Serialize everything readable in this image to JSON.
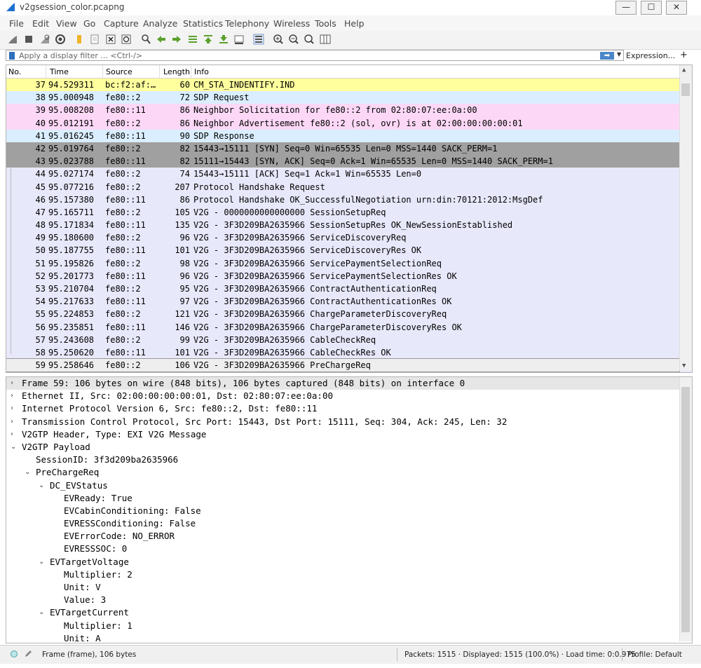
{
  "window": {
    "title": "v2gsession_color.pcapng",
    "min": "—",
    "max": "☐",
    "close": "✕"
  },
  "menu": [
    "File",
    "Edit",
    "View",
    "Go",
    "Capture",
    "Analyze",
    "Statistics",
    "Telephony",
    "Wireless",
    "Tools",
    "Help"
  ],
  "filter": {
    "placeholder": "Apply a display filter ... <Ctrl-/>",
    "apply_icon": "arrow-right-icon",
    "expression": "Expression...",
    "add": "+"
  },
  "columns": [
    "No.",
    "Time",
    "Source",
    "Length",
    "Info"
  ],
  "colors": {
    "yellow": "#ffff9e",
    "light_blue": "#daeeff",
    "pink": "#fcd8f6",
    "lavender": "#e8e8fb",
    "dark_gray": "#a0a0a0",
    "selected": "#eeeeee"
  },
  "packets": [
    {
      "no": "37",
      "time": "94.529311",
      "src": "bc:f2:af:…",
      "len": "60",
      "info": "CM_STA_INDENTIFY.IND",
      "color": "yellow"
    },
    {
      "no": "38",
      "time": "95.000948",
      "src": "fe80::2",
      "len": "72",
      "info": "SDP Request",
      "color": "light_blue"
    },
    {
      "no": "39",
      "time": "95.008208",
      "src": "fe80::11",
      "len": "86",
      "info": "Neighbor Solicitation for fe80::2 from 02:80:07:ee:0a:00",
      "color": "pink"
    },
    {
      "no": "40",
      "time": "95.012191",
      "src": "fe80::2",
      "len": "86",
      "info": "Neighbor Advertisement fe80::2 (sol, ovr) is at 02:00:00:00:00:01",
      "color": "pink"
    },
    {
      "no": "41",
      "time": "95.016245",
      "src": "fe80::11",
      "len": "90",
      "info": "SDP Response",
      "color": "light_blue"
    },
    {
      "no": "42",
      "time": "95.019764",
      "src": "fe80::2",
      "len": "82",
      "info": "15443→15111 [SYN] Seq=0 Win=65535 Len=0 MSS=1440 SACK_PERM=1",
      "color": "dark_gray"
    },
    {
      "no": "43",
      "time": "95.023788",
      "src": "fe80::11",
      "len": "82",
      "info": "15111→15443 [SYN, ACK] Seq=0 Ack=1 Win=65535 Len=0 MSS=1440 SACK_PERM=1",
      "color": "dark_gray"
    },
    {
      "no": "44",
      "time": "95.027174",
      "src": "fe80::2",
      "len": "74",
      "info": "15443→15111 [ACK] Seq=1 Ack=1 Win=65535 Len=0",
      "color": "lavender"
    },
    {
      "no": "45",
      "time": "95.077216",
      "src": "fe80::2",
      "len": "207",
      "info": "Protocol Handshake Request",
      "color": "lavender"
    },
    {
      "no": "46",
      "time": "95.157380",
      "src": "fe80::11",
      "len": "86",
      "info": "Protocol Handshake OK_SuccessfulNegotiation urn:din:70121:2012:MsgDef",
      "color": "lavender"
    },
    {
      "no": "47",
      "time": "95.165711",
      "src": "fe80::2",
      "len": "105",
      "info": "V2G - 0000000000000000 SessionSetupReq",
      "color": "lavender"
    },
    {
      "no": "48",
      "time": "95.171834",
      "src": "fe80::11",
      "len": "135",
      "info": "V2G - 3F3D209BA2635966 SessionSetupRes OK_NewSessionEstablished",
      "color": "lavender"
    },
    {
      "no": "49",
      "time": "95.180600",
      "src": "fe80::2",
      "len": "96",
      "info": "V2G - 3F3D209BA2635966 ServiceDiscoveryReq",
      "color": "lavender"
    },
    {
      "no": "50",
      "time": "95.187755",
      "src": "fe80::11",
      "len": "101",
      "info": "V2G - 3F3D209BA2635966 ServiceDiscoveryRes OK",
      "color": "lavender"
    },
    {
      "no": "51",
      "time": "95.195826",
      "src": "fe80::2",
      "len": "98",
      "info": "V2G - 3F3D209BA2635966 ServicePaymentSelectionReq",
      "color": "lavender"
    },
    {
      "no": "52",
      "time": "95.201773",
      "src": "fe80::11",
      "len": "96",
      "info": "V2G - 3F3D209BA2635966 ServicePaymentSelectionRes OK",
      "color": "lavender"
    },
    {
      "no": "53",
      "time": "95.210704",
      "src": "fe80::2",
      "len": "95",
      "info": "V2G - 3F3D209BA2635966 ContractAuthenticationReq",
      "color": "lavender"
    },
    {
      "no": "54",
      "time": "95.217633",
      "src": "fe80::11",
      "len": "97",
      "info": "V2G - 3F3D209BA2635966 ContractAuthenticationRes OK",
      "color": "lavender"
    },
    {
      "no": "55",
      "time": "95.224853",
      "src": "fe80::2",
      "len": "121",
      "info": "V2G - 3F3D209BA2635966 ChargeParameterDiscoveryReq",
      "color": "lavender"
    },
    {
      "no": "56",
      "time": "95.235851",
      "src": "fe80::11",
      "len": "146",
      "info": "V2G - 3F3D209BA2635966 ChargeParameterDiscoveryRes OK",
      "color": "lavender"
    },
    {
      "no": "57",
      "time": "95.243608",
      "src": "fe80::2",
      "len": "99",
      "info": "V2G - 3F3D209BA2635966 CableCheckReq",
      "color": "lavender"
    },
    {
      "no": "58",
      "time": "95.250620",
      "src": "fe80::11",
      "len": "101",
      "info": "V2G - 3F3D209BA2635966 CableCheckRes OK",
      "color": "lavender"
    },
    {
      "no": "59",
      "time": "95.258646",
      "src": "fe80::2",
      "len": "106",
      "info": "V2G - 3F3D209BA2635966 PreChargeReq",
      "color": "selected"
    }
  ],
  "details": [
    {
      "level": 0,
      "arrow": "›",
      "text": "Frame 59: 106 bytes on wire (848 bits), 106 bytes captured (848 bits) on interface 0",
      "highlight": true
    },
    {
      "level": 0,
      "arrow": "›",
      "text": "Ethernet II, Src: 02:00:00:00:00:01, Dst: 02:80:07:ee:0a:00"
    },
    {
      "level": 0,
      "arrow": "›",
      "text": "Internet Protocol Version 6, Src: fe80::2, Dst: fe80::11"
    },
    {
      "level": 0,
      "arrow": "›",
      "text": "Transmission Control Protocol, Src Port: 15443, Dst Port: 15111, Seq: 304, Ack: 245, Len: 32"
    },
    {
      "level": 0,
      "arrow": "›",
      "text": "V2GTP Header, Type: EXI V2G Message"
    },
    {
      "level": 0,
      "arrow": "⌄",
      "text": "V2GTP Payload"
    },
    {
      "level": 1,
      "arrow": "",
      "text": "SessionID: 3f3d209ba2635966"
    },
    {
      "level": 1,
      "arrow": "⌄",
      "text": "PreChargeReq"
    },
    {
      "level": 2,
      "arrow": "⌄",
      "text": "DC_EVStatus"
    },
    {
      "level": 3,
      "arrow": "",
      "text": "EVReady: True"
    },
    {
      "level": 3,
      "arrow": "",
      "text": "EVCabinConditioning: False"
    },
    {
      "level": 3,
      "arrow": "",
      "text": "EVRESSConditioning: False"
    },
    {
      "level": 3,
      "arrow": "",
      "text": "EVErrorCode: NO_ERROR"
    },
    {
      "level": 3,
      "arrow": "",
      "text": "EVRESSSOC: 0"
    },
    {
      "level": 2,
      "arrow": "⌄",
      "text": "EVTargetVoltage"
    },
    {
      "level": 3,
      "arrow": "",
      "text": "Multiplier: 2"
    },
    {
      "level": 3,
      "arrow": "",
      "text": "Unit: V"
    },
    {
      "level": 3,
      "arrow": "",
      "text": "Value: 3"
    },
    {
      "level": 2,
      "arrow": "⌄",
      "text": "EVTargetCurrent"
    },
    {
      "level": 3,
      "arrow": "",
      "text": "Multiplier: 1"
    },
    {
      "level": 3,
      "arrow": "",
      "text": "Unit: A"
    }
  ],
  "status": {
    "info": "Frame (frame), 106 bytes",
    "packets": "Packets: 1515 · Displayed: 1515 (100.0%) · Load time: 0:0.975",
    "profile": "Profile: Default"
  }
}
